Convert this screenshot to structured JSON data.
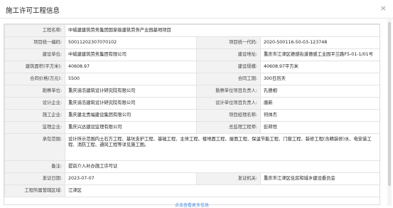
{
  "dialog": {
    "title": "施工许可工程信息",
    "close": "×"
  },
  "rows": [
    {
      "l1": "工程名称:",
      "v1": "中城建建筑劳务集团国家级建筑劳务产业园基地项目",
      "span": true
    },
    {
      "l1": "项目统一编码:",
      "v1": "5001120230707​0102",
      "l2": "项目统一代码:",
      "v2": "2020-500116-50-03-123748"
    },
    {
      "l1": "建设单位:",
      "v1": "中城建建筑劳务集团有限公司",
      "l2": "建设地址:",
      "v2": "重庆市江津区德感街道德感工业园平兰路F5-01-1/01号"
    },
    {
      "l1": "建筑面积(平方米):",
      "v1": "40608.97",
      "l2": "建设规模:",
      "v2": "40608.97平方米"
    },
    {
      "l1": "合同价格(万元):",
      "v1": "5500",
      "l2": "合同工期:",
      "v2": "300日历天"
    },
    {
      "l1": "勘察单位:",
      "v1": "重庆渝浩建筑设计研究院有限公司",
      "l2": "勘察单位项目负责人:",
      "v2": "孔德相"
    },
    {
      "l1": "设计企业:",
      "v1": "重庆渝浩建筑设计研究院有限公司",
      "l2": "设计单位项目负责人:",
      "v2": "唐新"
    },
    {
      "l1": "施工企业:",
      "v1": "重庆建北贵福建设集团有限公司",
      "l2": "项目经理名称:",
      "v2": "何帅杰"
    },
    {
      "l1": "监理企业:",
      "v1": "重庆兴达建设监理有限公司",
      "l2": "总监理工程师:",
      "v2": "彭邦恒"
    },
    {
      "l1": "承包范围:",
      "v1": "设计所示范围内土石方工程、基坑支护工程、基础工程、主体工程、楼地面工程、屋面工程、保温节能工程、门窗工程、装修工程(含精装修)水、电安装工程、消防工程、通风工程等详见施工图。",
      "span": true,
      "tall": true
    },
    {
      "l1": "备注:",
      "v1": "提前介入补办施工许可证",
      "span": true
    },
    {
      "l1": "发证日期:",
      "v1": "2023-07-07",
      "l2": "发证机关:",
      "v2": "重庆市江津区住房和城乡建设委员会"
    },
    {
      "l1": "工程所属管辖区域:",
      "v1": "江津区",
      "span": true
    }
  ],
  "footer": {
    "more": "点击查看更多信息"
  }
}
